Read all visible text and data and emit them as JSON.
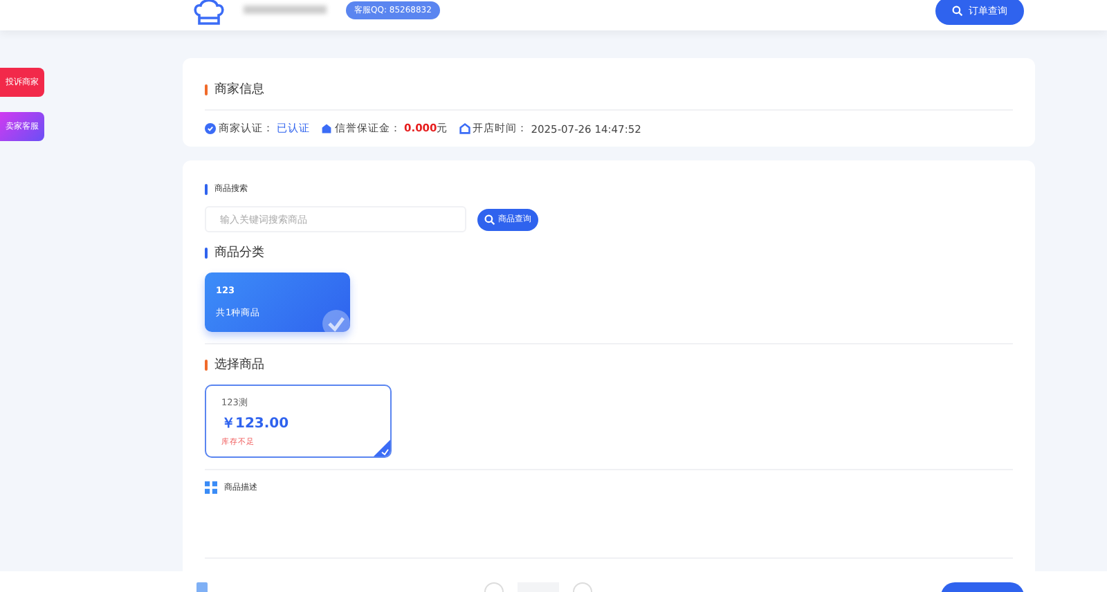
{
  "header": {
    "support_badge": "客服QQ: 85268832",
    "order_button": "订单查询"
  },
  "side_buttons": [
    {
      "label": "投诉商家",
      "kind": "complaint"
    },
    {
      "label": "卖家客服",
      "kind": "service"
    }
  ],
  "merchant": {
    "title": "商家信息",
    "verify_label": "商家认证：",
    "verify_value": "已认证",
    "deposit_label": "信誉保证金：",
    "deposit_value": "0.000",
    "deposit_unit": "元",
    "open_label": "开店时间：",
    "open_value": "2025-07-26 14:47:52"
  },
  "search": {
    "title": "商品搜索",
    "placeholder": "输入关键词搜索商品",
    "button": "商品查询"
  },
  "categories": {
    "title": "商品分类",
    "items": [
      {
        "name": "123",
        "count": "共1种商品",
        "selected": true
      }
    ]
  },
  "products": {
    "title": "选择商品",
    "items": [
      {
        "name": "123测",
        "price": "￥123.00",
        "stock": "库存不足",
        "selected": true
      }
    ]
  },
  "description": {
    "title": "商品描述"
  }
}
